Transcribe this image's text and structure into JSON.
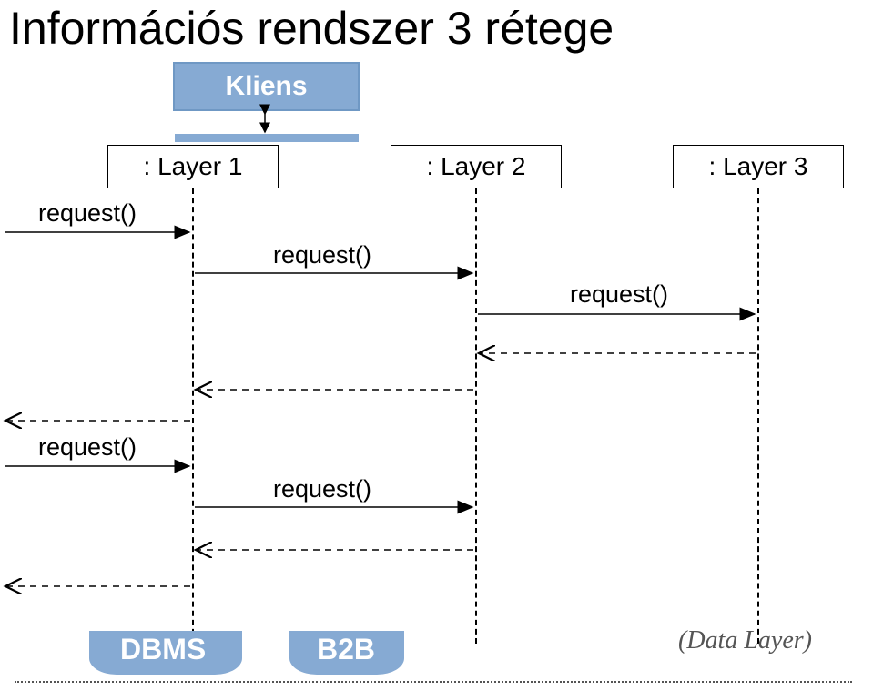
{
  "title": "Információs rendszer 3 rétege",
  "kliens_label": "Kliens",
  "layers": {
    "l1": ": Layer 1",
    "l2": ": Layer 2",
    "l3": ": Layer 3"
  },
  "messages": {
    "req1": "request()",
    "req2": "request()",
    "req3": "request()",
    "req4": "request()",
    "req5": "request()"
  },
  "bottom": {
    "dbms": "DBMS",
    "b2b": "B2B",
    "right": "(Data Layer)"
  },
  "chart_data": {
    "type": "sequence-diagram",
    "title": "Információs rendszer 3 rétege",
    "participants": [
      "(external)",
      "Layer 1",
      "Layer 2",
      "Layer 3"
    ],
    "messages": [
      {
        "from": "(external)",
        "to": "Layer 1",
        "label": "request()",
        "dashed": false
      },
      {
        "from": "Layer 1",
        "to": "Layer 2",
        "label": "request()",
        "dashed": false
      },
      {
        "from": "Layer 2",
        "to": "Layer 3",
        "label": "request()",
        "dashed": false
      },
      {
        "from": "Layer 3",
        "to": "Layer 2",
        "label": "",
        "dashed": true
      },
      {
        "from": "Layer 2",
        "to": "Layer 1",
        "label": "",
        "dashed": true
      },
      {
        "from": "Layer 1",
        "to": "(external)",
        "label": "",
        "dashed": true
      },
      {
        "from": "(external)",
        "to": "Layer 1",
        "label": "request()",
        "dashed": false
      },
      {
        "from": "Layer 1",
        "to": "Layer 2",
        "label": "request()",
        "dashed": false
      },
      {
        "from": "Layer 2",
        "to": "Layer 1",
        "label": "",
        "dashed": true
      },
      {
        "from": "Layer 1",
        "to": "(external)",
        "label": "",
        "dashed": true
      }
    ]
  }
}
